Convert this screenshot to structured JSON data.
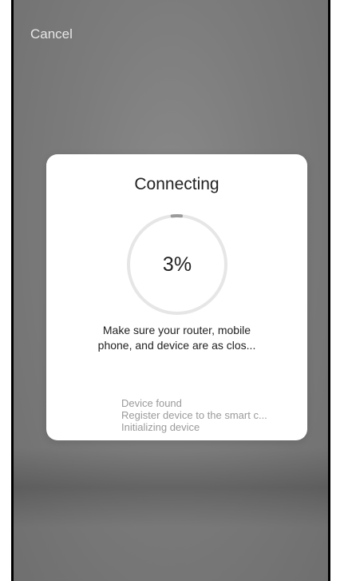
{
  "header": {
    "cancel_label": "Cancel"
  },
  "dialog": {
    "title": "Connecting",
    "progress_label": "3%",
    "progress_value": 0.03,
    "message_line1": "Make sure your router, mobile",
    "message_line2": "phone, and device are as clos...",
    "steps": [
      "Device found",
      "Register device to the smart c...",
      "Initializing device"
    ]
  },
  "colors": {
    "ring_track": "#e6e6e6",
    "ring_progress": "#9b9b9b",
    "step_text": "#9a9a9a"
  }
}
